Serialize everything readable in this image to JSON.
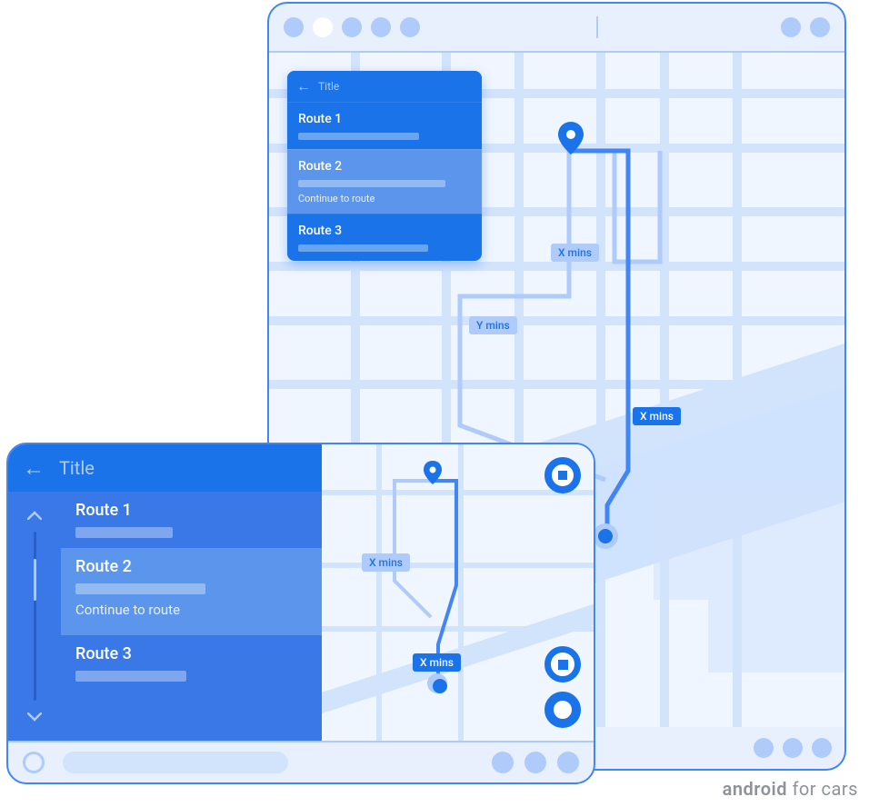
{
  "attribution": {
    "brand": "android",
    "suffix": " for cars"
  },
  "portrait": {
    "card": {
      "header_title": "Title",
      "routes": [
        {
          "label": "Route 1"
        },
        {
          "label": "Route 2",
          "secondary": "Continue to route",
          "selected": true
        },
        {
          "label": "Route 3"
        }
      ]
    },
    "map_labels": {
      "primary": "X mins",
      "alt1": "X mins",
      "alt2": "Y mins"
    }
  },
  "landscape": {
    "panel": {
      "header_title": "Title",
      "routes": [
        {
          "label": "Route 1"
        },
        {
          "label": "Route 2",
          "secondary": "Continue to route",
          "selected": true
        },
        {
          "label": "Route 3"
        }
      ]
    },
    "map_labels": {
      "primary": "X mins",
      "alt": "X mins"
    }
  }
}
